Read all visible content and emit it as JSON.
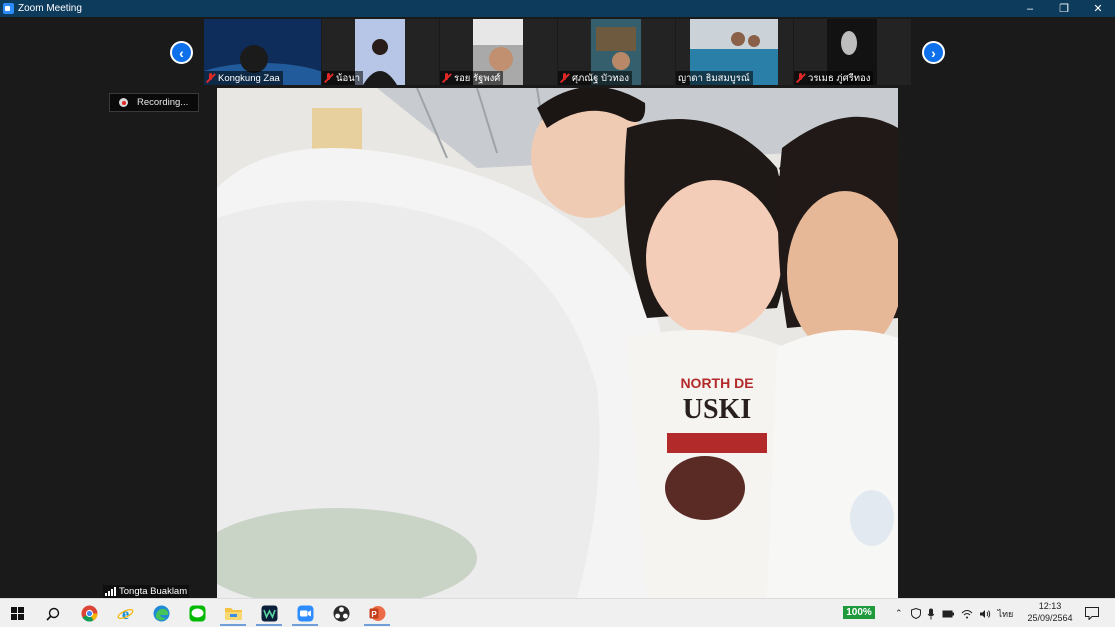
{
  "window": {
    "title": "Zoom Meeting",
    "controls": [
      "minimize",
      "restore",
      "close"
    ]
  },
  "strip": {
    "prev_label": "‹",
    "next_label": "›",
    "participants": [
      {
        "name": "Kongkung Zaa",
        "muted": true,
        "thumb_color": "#0f2d5a"
      },
      {
        "name": "น้อนา",
        "muted": true,
        "thumb_color": "#b7c6e6"
      },
      {
        "name": "รอย รัฐพงศ์",
        "muted": true,
        "thumb_color": "#a9a9a9"
      },
      {
        "name": "ศุภณัฐ บัวทอง",
        "muted": true,
        "thumb_color": "#355f6d"
      },
      {
        "name": "ญาดา ธิมสมบูรณ์",
        "muted": false,
        "thumb_color": "#cbd3d8"
      },
      {
        "name": "วรเมธ ภู่ศรีทอง",
        "muted": true,
        "thumb_color": "#121212"
      }
    ]
  },
  "recording": {
    "label": "Recording..."
  },
  "active_speaker": {
    "name": "Tongta Buaklam"
  },
  "taskbar": {
    "apps": [
      "windows-start",
      "search",
      "chrome",
      "internet-explorer",
      "edge",
      "line",
      "file-explorer",
      "webex",
      "zoom",
      "obs",
      "powerpoint"
    ],
    "battery_percent": "100%",
    "input_lang": "ไทย",
    "time": "12:13",
    "date": "25/09/2564"
  },
  "colors": {
    "accent": "#0e71eb",
    "titlebar": "#0d3b5c",
    "muted": "#e02828",
    "battery": "#1e9a3c"
  }
}
